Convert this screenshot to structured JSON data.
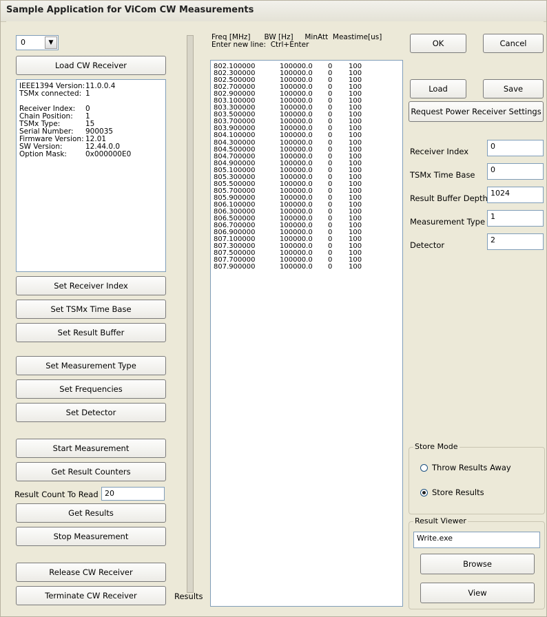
{
  "window": {
    "title": "Sample Application for ViCom CW Measurements"
  },
  "receiver_select": {
    "value": "0"
  },
  "left_buttons": {
    "load": "Load CW Receiver",
    "set_index": "Set Receiver Index",
    "set_time_base": "Set TSMx Time Base",
    "set_result_buffer": "Set Result Buffer",
    "set_measurement_type": "Set Measurement Type",
    "set_frequencies": "Set Frequencies",
    "set_detector": "Set Detector",
    "start": "Start Measurement",
    "get_counters": "Get Result Counters",
    "get_results": "Get Results",
    "stop": "Stop Measurement",
    "release": "Release CW Receiver",
    "terminate": "Terminate CW Receiver"
  },
  "info": [
    {
      "k": "IEEE1394 Version:",
      "v": "11.0.0.4"
    },
    {
      "k": "TSMx connected:",
      "v": "1"
    },
    {
      "k": "",
      "v": ""
    },
    {
      "k": "Receiver Index:",
      "v": "0"
    },
    {
      "k": "Chain Position:",
      "v": "1"
    },
    {
      "k": "TSMx Type:",
      "v": "15"
    },
    {
      "k": "Serial Number:",
      "v": "900035"
    },
    {
      "k": "Firmware Version:",
      "v": "12.01"
    },
    {
      "k": "SW Version:",
      "v": "12.44.0.0"
    },
    {
      "k": "Option Mask:",
      "v": "0x000000E0"
    }
  ],
  "result_count": {
    "label": "Result Count To Read",
    "value": "20"
  },
  "results_label": "Results",
  "freq_header": {
    "line1": "Freq [MHz]      BW [Hz]     MinAtt  Meastime[us]",
    "line2": "Enter new line:  Ctrl+Enter"
  },
  "freq_rows": [
    [
      "802.100000",
      "100000.0",
      "0",
      "100"
    ],
    [
      "802.300000",
      "100000.0",
      "0",
      "100"
    ],
    [
      "802.500000",
      "100000.0",
      "0",
      "100"
    ],
    [
      "802.700000",
      "100000.0",
      "0",
      "100"
    ],
    [
      "802.900000",
      "100000.0",
      "0",
      "100"
    ],
    [
      "803.100000",
      "100000.0",
      "0",
      "100"
    ],
    [
      "803.300000",
      "100000.0",
      "0",
      "100"
    ],
    [
      "803.500000",
      "100000.0",
      "0",
      "100"
    ],
    [
      "803.700000",
      "100000.0",
      "0",
      "100"
    ],
    [
      "803.900000",
      "100000.0",
      "0",
      "100"
    ],
    [
      "804.100000",
      "100000.0",
      "0",
      "100"
    ],
    [
      "804.300000",
      "100000.0",
      "0",
      "100"
    ],
    [
      "804.500000",
      "100000.0",
      "0",
      "100"
    ],
    [
      "804.700000",
      "100000.0",
      "0",
      "100"
    ],
    [
      "804.900000",
      "100000.0",
      "0",
      "100"
    ],
    [
      "805.100000",
      "100000.0",
      "0",
      "100"
    ],
    [
      "805.300000",
      "100000.0",
      "0",
      "100"
    ],
    [
      "805.500000",
      "100000.0",
      "0",
      "100"
    ],
    [
      "805.700000",
      "100000.0",
      "0",
      "100"
    ],
    [
      "805.900000",
      "100000.0",
      "0",
      "100"
    ],
    [
      "806.100000",
      "100000.0",
      "0",
      "100"
    ],
    [
      "806.300000",
      "100000.0",
      "0",
      "100"
    ],
    [
      "806.500000",
      "100000.0",
      "0",
      "100"
    ],
    [
      "806.700000",
      "100000.0",
      "0",
      "100"
    ],
    [
      "806.900000",
      "100000.0",
      "0",
      "100"
    ],
    [
      "807.100000",
      "100000.0",
      "0",
      "100"
    ],
    [
      "807.300000",
      "100000.0",
      "0",
      "100"
    ],
    [
      "807.500000",
      "100000.0",
      "0",
      "100"
    ],
    [
      "807.700000",
      "100000.0",
      "0",
      "100"
    ],
    [
      "807.900000",
      "100000.0",
      "0",
      "100"
    ]
  ],
  "right_buttons": {
    "ok": "OK",
    "cancel": "Cancel",
    "load": "Load",
    "save": "Save",
    "request": "Request Power Receiver Settings",
    "browse": "Browse",
    "view": "View"
  },
  "settings": [
    {
      "label": "Receiver Index",
      "value": "0"
    },
    {
      "label": "TSMx Time Base",
      "value": "0"
    },
    {
      "label": "Result Buffer Depth",
      "value": "1024"
    },
    {
      "label": "Measurement Type",
      "value": "1"
    },
    {
      "label": "Detector",
      "value": "2"
    }
  ],
  "store_mode": {
    "title": "Store Mode",
    "throw": "Throw Results Away",
    "store": "Store Results",
    "selected": "store"
  },
  "result_viewer": {
    "title": "Result Viewer",
    "value": "Write.exe"
  }
}
